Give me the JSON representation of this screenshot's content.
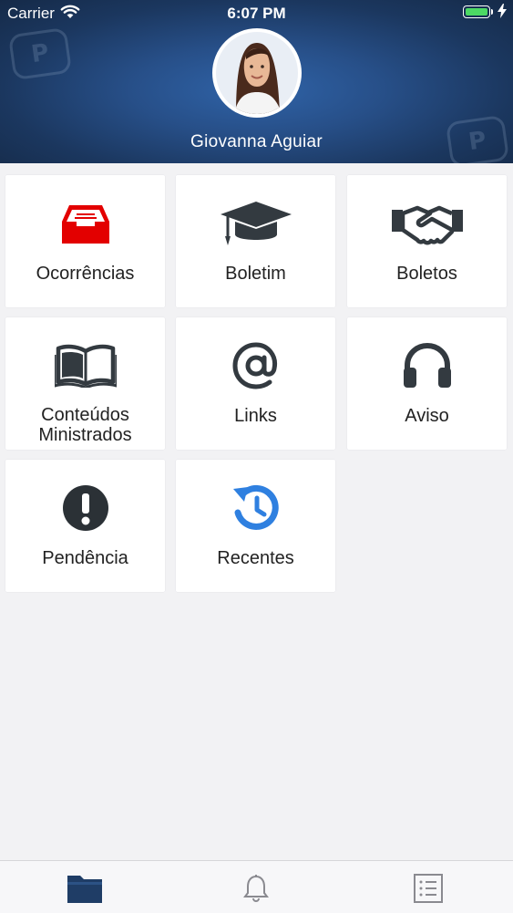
{
  "status_bar": {
    "carrier": "Carrier",
    "time": "6:07 PM",
    "battery_level": 1.0,
    "battery_color": "#4cd964",
    "wifi_icon": "wifi-icon",
    "charging_icon": "bolt-icon"
  },
  "profile": {
    "name": "Giovanna Aguiar",
    "avatar_icon": "user-photo"
  },
  "menu": [
    {
      "label": "Ocorrências",
      "icon": "inbox-icon",
      "color": "#e30000"
    },
    {
      "label": "Boletim",
      "icon": "graduation-cap-icon",
      "color": "#333a40"
    },
    {
      "label": "Boletos",
      "icon": "handshake-icon",
      "color": "#333a40"
    },
    {
      "label_line1": "Conteúdos",
      "label_line2": "Ministrados",
      "icon": "open-book-icon",
      "color": "#333a40"
    },
    {
      "label": "Links",
      "icon": "at-sign-icon",
      "color": "#333a40"
    },
    {
      "label": "Aviso",
      "icon": "headphones-icon",
      "color": "#333a40"
    },
    {
      "label": "Pendência",
      "icon": "exclamation-circle-icon",
      "color": "#2b3136"
    },
    {
      "label": "Recentes",
      "icon": "history-icon",
      "color": "#2f80e0"
    }
  ],
  "tab_bar": {
    "active_color": "#1f3d66",
    "items": [
      {
        "icon": "folder-icon",
        "active": true
      },
      {
        "icon": "bell-icon",
        "active": false
      },
      {
        "icon": "list-icon",
        "active": false
      }
    ]
  }
}
